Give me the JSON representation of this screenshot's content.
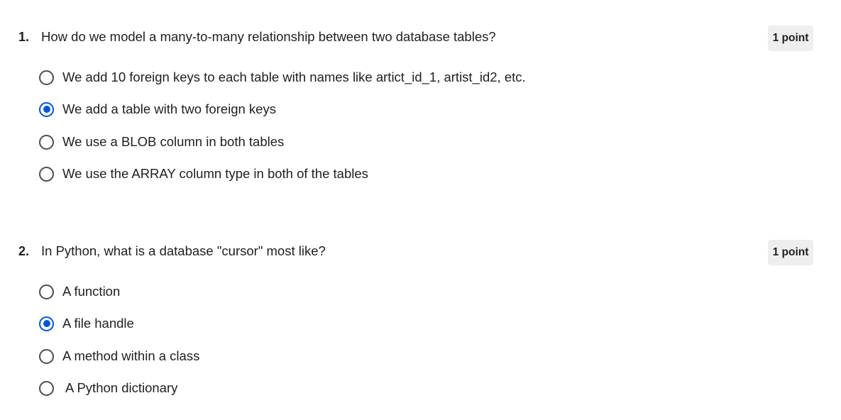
{
  "questions": [
    {
      "number": "1.",
      "text": "How do we model a many-to-many relationship between two database tables?",
      "points": "1 point",
      "options": [
        {
          "label": "We add 10 foreign keys to each table with names like artict_id_1, artist_id2, etc.",
          "selected": false
        },
        {
          "label": "We add a table with two foreign keys",
          "selected": true
        },
        {
          "label": "We use a BLOB column in both tables",
          "selected": false
        },
        {
          "label": "We use the ARRAY column type in both of the tables",
          "selected": false
        }
      ]
    },
    {
      "number": "2.",
      "text": "In Python, what is a database \"cursor\" most like?",
      "points": "1 point",
      "options": [
        {
          "label": "A function",
          "selected": false
        },
        {
          "label": "A file handle",
          "selected": true
        },
        {
          "label": "A method within a class",
          "selected": false
        },
        {
          "label": "A Python dictionary",
          "selected": false
        }
      ]
    }
  ],
  "colors": {
    "accent": "#0056d2",
    "radio_border": "#4d4d4d",
    "points_badge_bg": "#eeeeee",
    "text": "#1f1f1f"
  }
}
